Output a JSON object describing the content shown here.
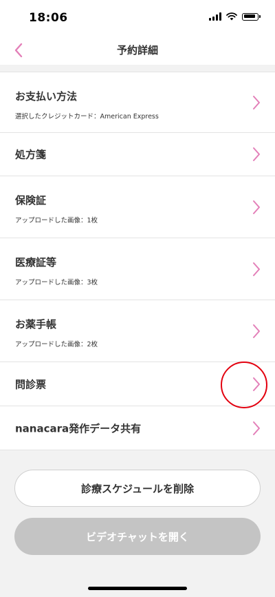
{
  "status_bar": {
    "time": "18:06"
  },
  "header": {
    "title": "予約詳細"
  },
  "rows": [
    {
      "title": "お支払い方法",
      "subtitle": "選択したクレジットカード：American Express"
    },
    {
      "title": "処方箋"
    },
    {
      "title": "保険証",
      "subtitle": "アップロードした画像：1枚"
    },
    {
      "title": "医療証等",
      "subtitle": "アップロードした画像：3枚"
    },
    {
      "title": "お薬手帳",
      "subtitle": "アップロードした画像：2枚"
    },
    {
      "title": "問診票"
    },
    {
      "title": "nanacara発作データ共有"
    }
  ],
  "buttons": {
    "delete_schedule": "診療スケジュールを削除",
    "open_video_chat": "ビデオチャットを開く"
  },
  "colors": {
    "accent": "#e37fb8",
    "highlight": "#e3000f",
    "disabled": "#c4c4c4"
  },
  "icons": {
    "back": "chevron-left-icon",
    "row_chevron": "chevron-right-icon"
  }
}
